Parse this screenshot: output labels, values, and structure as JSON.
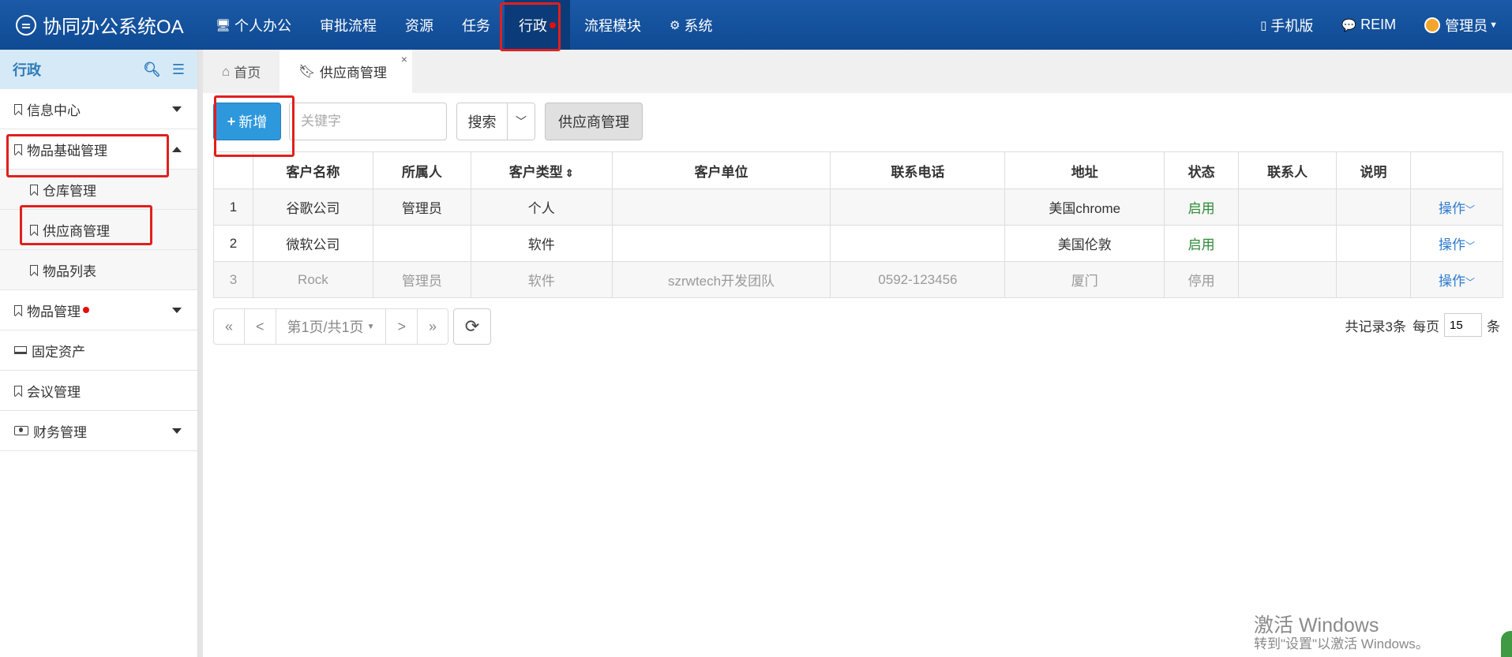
{
  "app": {
    "title": "协同办公系统OA"
  },
  "topnav": {
    "items": [
      {
        "label": "个人办公",
        "icon": "monitor-icon"
      },
      {
        "label": "审批流程"
      },
      {
        "label": "资源"
      },
      {
        "label": "任务"
      },
      {
        "label": "行政",
        "active": true,
        "badge": "red-dot"
      },
      {
        "label": "流程模块"
      },
      {
        "label": "系统",
        "icon": "gear-icon"
      }
    ],
    "right": [
      {
        "label": "手机版",
        "icon": "mobile-icon"
      },
      {
        "label": "REIM",
        "icon": "chat-icon"
      },
      {
        "label": "管理员",
        "icon": "avatar-icon"
      }
    ]
  },
  "sidebar": {
    "title": "行政",
    "items": [
      {
        "label": "信息中心",
        "icon": "bookmark-icon",
        "caret": "down"
      },
      {
        "label": "物品基础管理",
        "icon": "bookmark-icon",
        "caret": "up"
      },
      {
        "label": "仓库管理",
        "icon": "bookmark-icon",
        "sub": true
      },
      {
        "label": "供应商管理",
        "icon": "bookmark-icon",
        "sub": true
      },
      {
        "label": "物品列表",
        "icon": "bookmark-icon",
        "sub": true
      },
      {
        "label": "物品管理",
        "icon": "bookmark-icon",
        "caret": "down",
        "badge": "red-dot"
      },
      {
        "label": "固定资产",
        "icon": "laptop-icon"
      },
      {
        "label": "会议管理",
        "icon": "bookmark-icon"
      },
      {
        "label": "财务管理",
        "icon": "money-icon",
        "caret": "down"
      }
    ]
  },
  "tabs": [
    {
      "label": "首页",
      "icon": "home-icon"
    },
    {
      "label": "供应商管理",
      "icon": "bookmark-icon",
      "active": true,
      "close": "×"
    }
  ],
  "toolbar": {
    "add_label": "新增",
    "search_placeholder": "关键字",
    "search_label": "搜索",
    "module_label": "供应商管理"
  },
  "table": {
    "headers": [
      "",
      "客户名称",
      "所属人",
      "客户类型",
      "客户单位",
      "联系电话",
      "地址",
      "状态",
      "联系人",
      "说明",
      ""
    ],
    "rows": [
      [
        "1",
        "谷歌公司",
        "管理员",
        "个人",
        "",
        "",
        "美国chrome",
        "启用",
        "",
        "",
        "操作"
      ],
      [
        "2",
        "微软公司",
        "",
        "软件",
        "",
        "",
        "美国伦敦",
        "启用",
        "",
        "",
        "操作"
      ],
      [
        "3",
        "Rock",
        "管理员",
        "软件",
        "szrwtech开发团队",
        "0592-123456",
        "厦门",
        "停用",
        "",
        "",
        "操作"
      ]
    ]
  },
  "pager": {
    "first": "«",
    "prev": "<",
    "page_label": "第1页/共1页",
    "next": ">",
    "last": "»",
    "total_text": "共记录3条",
    "per_page_label": "每页",
    "per_page_value": "15",
    "per_page_unit": "条"
  },
  "watermark": {
    "line1": "激活 Windows",
    "line2": "转到\"设置\"以激活 Windows。"
  },
  "colors": {
    "topbar": "#1b5aa7",
    "accent": "#2e98dd",
    "status_on": "#2e8b37",
    "annotation": "#e0201e"
  }
}
